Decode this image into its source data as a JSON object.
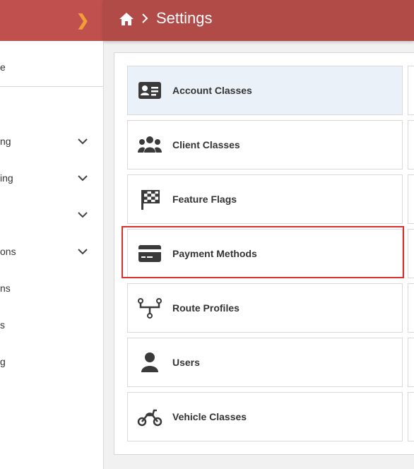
{
  "header": {
    "title": "Settings"
  },
  "sidebar": {
    "user_fragment": "e",
    "items": [
      {
        "label": "ng",
        "has_chevron": true
      },
      {
        "label": "ing",
        "has_chevron": true
      },
      {
        "label": "",
        "has_chevron": true
      },
      {
        "label": "ons",
        "has_chevron": true
      },
      {
        "label": "ns",
        "has_chevron": false
      },
      {
        "label": "s",
        "has_chevron": false
      },
      {
        "label": "g",
        "has_chevron": false
      }
    ]
  },
  "settings": {
    "cards": [
      {
        "label": "Account Classes",
        "icon": "id-card-icon",
        "active": true
      },
      {
        "label": "Client Classes",
        "icon": "users-group-icon",
        "active": false
      },
      {
        "label": "Feature Flags",
        "icon": "checkered-flag-icon",
        "active": false
      },
      {
        "label": "Payment Methods",
        "icon": "credit-card-icon",
        "active": false,
        "highlighted": true
      },
      {
        "label": "Route Profiles",
        "icon": "route-icon",
        "active": false
      },
      {
        "label": "Users",
        "icon": "user-icon",
        "active": false
      },
      {
        "label": "Vehicle Classes",
        "icon": "motorcycle-icon",
        "active": false
      }
    ]
  },
  "colors": {
    "topbar": "#b04b48",
    "sidebar_top": "#c0504d",
    "toggle_accent": "#f29d38",
    "active_card": "#ebf1f9",
    "highlight_border": "#d9302c"
  }
}
